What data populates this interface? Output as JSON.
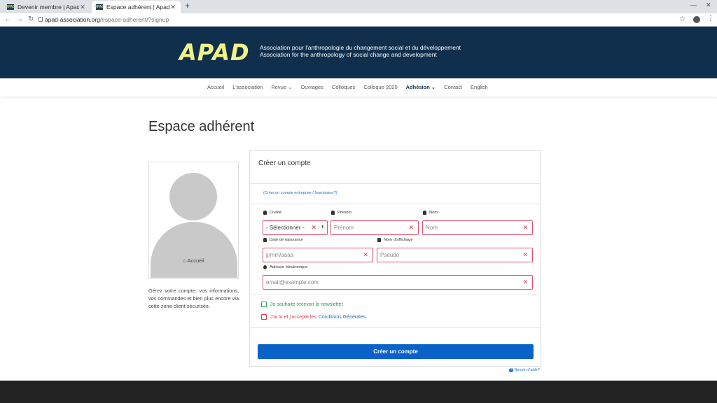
{
  "browser": {
    "tabs": [
      {
        "title": "Devenir membre | Apad",
        "favicon": "APAD"
      },
      {
        "title": "Espace adhérent | Apad",
        "favicon": "APAD"
      }
    ],
    "new_tab": "+",
    "url_host": "apad-association.org",
    "url_path": "/espace-adherent/?signup"
  },
  "header": {
    "logo": "APAD",
    "tagline_fr": "Association pour l'anthropologie du changement social et du développement",
    "tagline_en": "Association for the anthropology of social change and development"
  },
  "nav": {
    "items": [
      "Accueil",
      "L'association",
      "Revue ⌄",
      "Ouvrages",
      "Colloques",
      "Colloque 2020",
      "Adhésion ⌄",
      "Contact",
      "English"
    ]
  },
  "page": {
    "title": "Espace adhérent",
    "profile_home": "Accueil",
    "description": "Gérez votre compte, vos informations, vos commandes et bien plus encore via cette zone client sécurisée."
  },
  "form": {
    "heading": "Créer un compte",
    "company_link": "(Créer un compte entreprise / fournisseur?)",
    "labels": {
      "civility": "Civilité",
      "firstname": "Prénom",
      "lastname": "Nom",
      "birthdate": "Date de naissance",
      "display_name": "Nom d'affichage",
      "email": "Adresse électronique"
    },
    "fields": {
      "civility": "- Sélectionner -",
      "firstname_placeholder": "Prénom",
      "lastname_placeholder": "Nom",
      "birthdate_placeholder": "jj/mm/aaaa",
      "pseudo_placeholder": "Pseudo",
      "email_placeholder": "email@example.com"
    },
    "newsletter": "Je souhaite recevoir la newsletter",
    "terms_prefix": "J'ai lu et j'accepte les",
    "terms_link": "Conditions Générales.",
    "submit": "Créer un compte",
    "help": "Besoin d'aide?"
  },
  "colors": {
    "header_bg": "#0f2f4d",
    "logo": "#f2f28a",
    "primary": "#0a62c9",
    "error": "#e0364f",
    "success": "#22a04a"
  }
}
